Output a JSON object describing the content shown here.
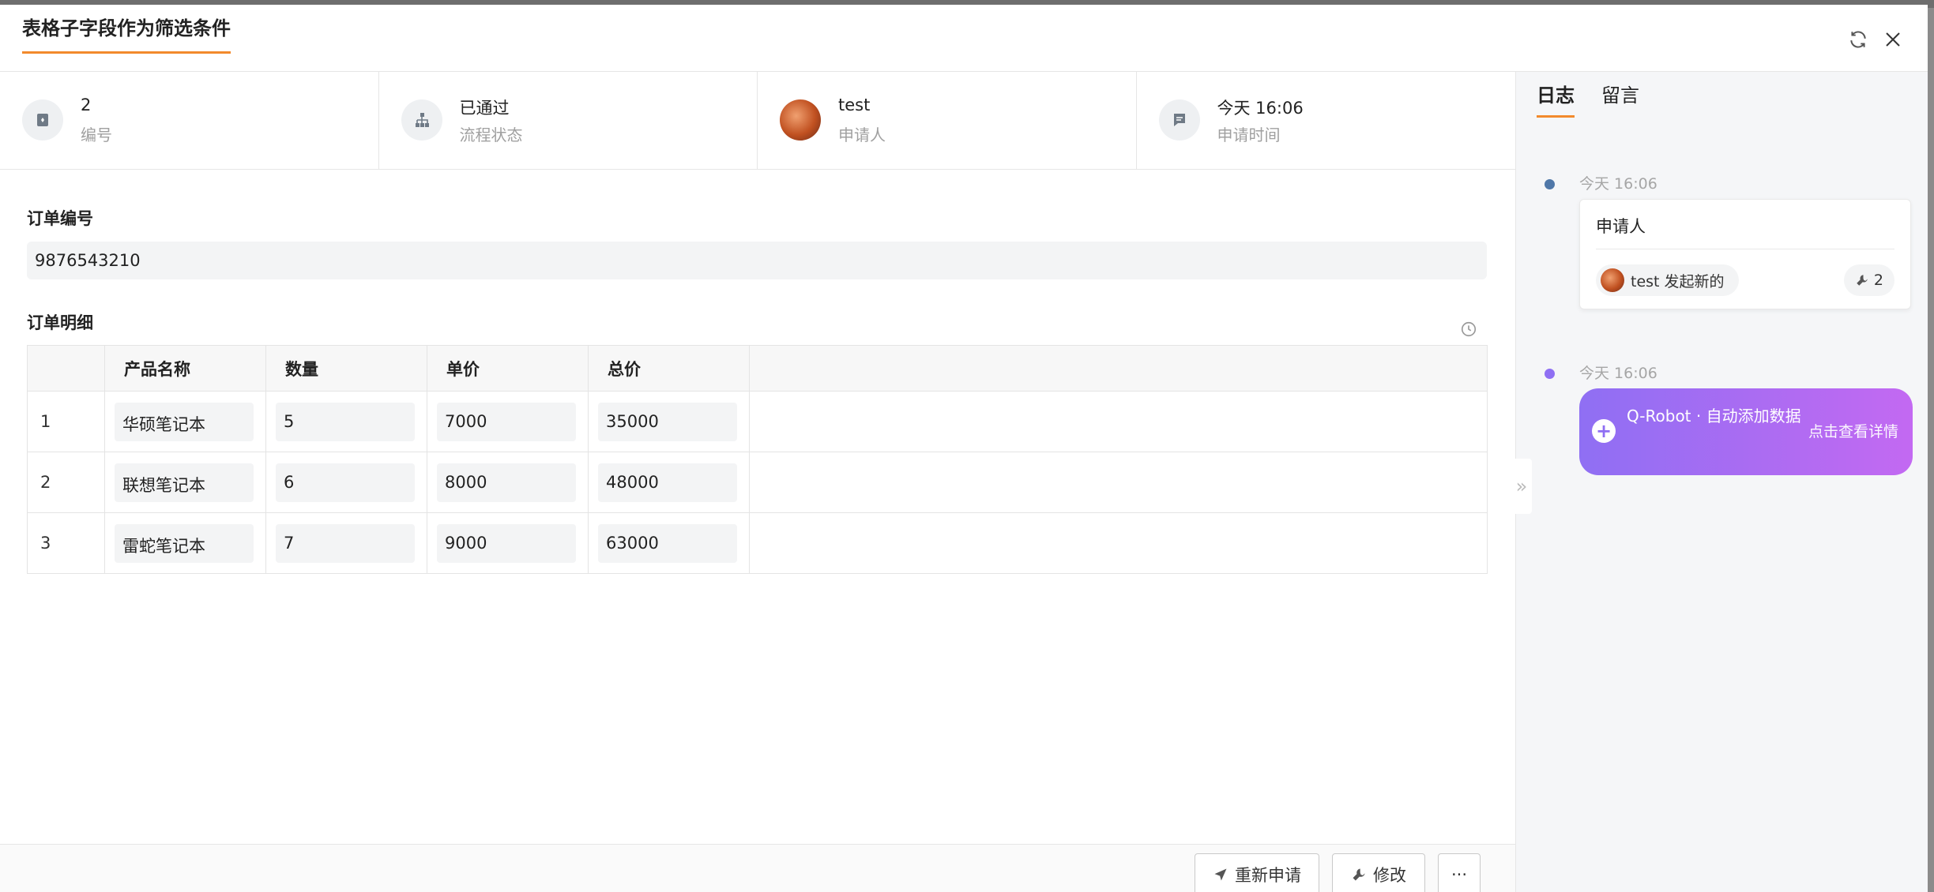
{
  "header": {
    "title": "表格子字段作为筛选条件"
  },
  "info": [
    {
      "value": "2",
      "label": "编号",
      "icon": "bookmark-icon"
    },
    {
      "value": "已通过",
      "label": "流程状态",
      "icon": "flow-icon"
    },
    {
      "value": "test",
      "label": "申请人",
      "icon": "avatar"
    },
    {
      "value": "今天 16:06",
      "label": "申请时间",
      "icon": "message-icon"
    }
  ],
  "order_no": {
    "label": "订单编号",
    "value": "9876543210"
  },
  "details": {
    "label": "订单明细",
    "columns": [
      "产品名称",
      "数量",
      "单价",
      "总价"
    ],
    "rows": [
      {
        "idx": "1",
        "name": "华硕笔记本",
        "qty": "5",
        "price": "7000",
        "total": "35000"
      },
      {
        "idx": "2",
        "name": "联想笔记本",
        "qty": "6",
        "price": "8000",
        "total": "48000"
      },
      {
        "idx": "3",
        "name": "雷蛇笔记本",
        "qty": "7",
        "price": "9000",
        "total": "63000"
      }
    ]
  },
  "footer": {
    "reapply": "重新申请",
    "modify": "修改",
    "more": "···"
  },
  "side": {
    "tabs": [
      "日志",
      "留言"
    ],
    "log1": {
      "time": "今天 16:06",
      "title": "申请人",
      "chip": "test 发起新的",
      "count": "2"
    },
    "log2": {
      "time": "今天 16:06",
      "text": "Q-Robot · 自动添加数据",
      "link": "点击查看详情"
    }
  },
  "colors": {
    "accent": "#f28a2c",
    "robot_start": "#8f6ff3",
    "robot_end": "#c369f2",
    "dot1": "#4f77a8",
    "dot2": "#8f6ff3"
  }
}
